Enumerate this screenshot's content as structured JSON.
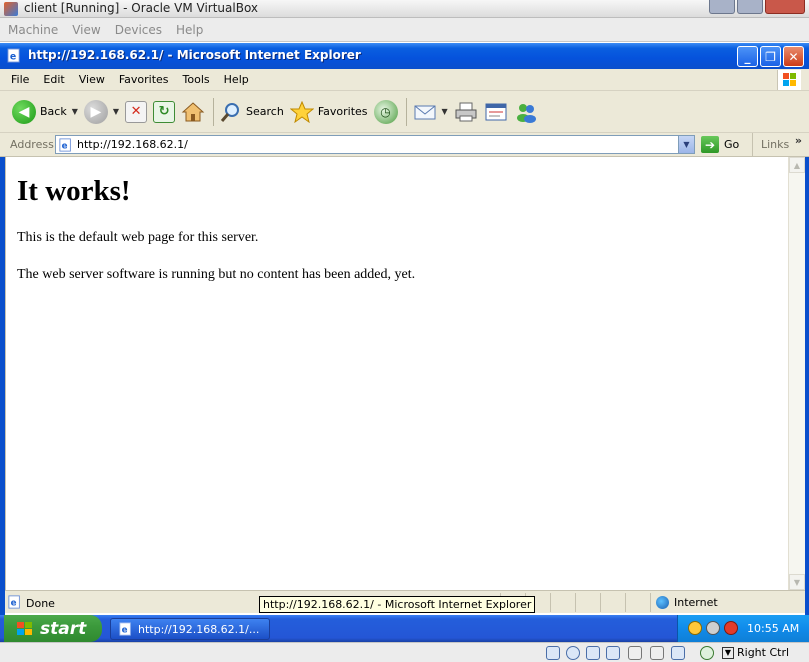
{
  "vbox": {
    "title": "client [Running] - Oracle VM VirtualBox",
    "menu": [
      "Machine",
      "View",
      "Devices",
      "Help"
    ],
    "host_key": "Right Ctrl"
  },
  "ie": {
    "title": "http://192.168.62.1/ - Microsoft Internet Explorer",
    "menu": [
      "File",
      "Edit",
      "View",
      "Favorites",
      "Tools",
      "Help"
    ],
    "toolbar": {
      "back_label": "Back",
      "search_label": "Search",
      "favorites_label": "Favorites"
    },
    "address": {
      "label": "Address",
      "value": "http://192.168.62.1/",
      "go_label": "Go",
      "links_label": "Links"
    },
    "status": {
      "text": "Done",
      "zone": "Internet"
    },
    "tooltip": "http://192.168.62.1/ - Microsoft Internet Explorer"
  },
  "page": {
    "heading": "It works!",
    "paragraph1": "This is the default web page for this server.",
    "paragraph2": "The web server software is running but no content has been added, yet."
  },
  "taskbar": {
    "start_label": "start",
    "task_label": "http://192.168.62.1/...",
    "clock": "10:55 AM"
  },
  "colors": {
    "xp_title_blue": "#0552dc",
    "xp_start_green": "#3c9a3c",
    "tray_blue": "#108bea",
    "ie_chrome": "#ece9d8"
  }
}
